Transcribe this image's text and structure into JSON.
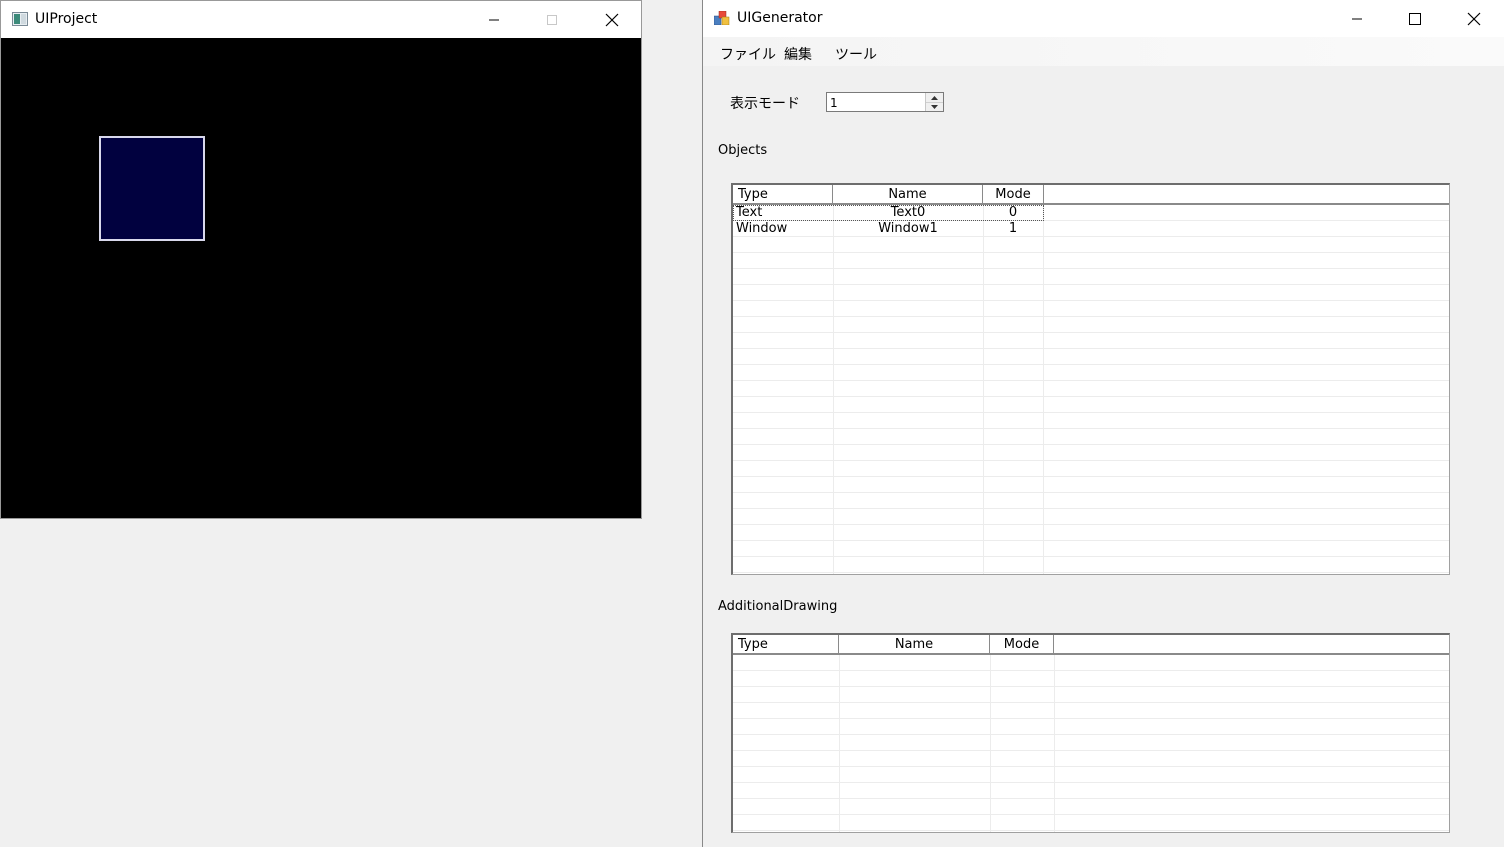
{
  "uiproject": {
    "title": "UIProject",
    "controls": {
      "minimize": "minimize-icon",
      "maximize": "maximize-icon",
      "close": "close-icon"
    },
    "canvas_bg": "#000000",
    "window_fill": "#01013f"
  },
  "uigenerator": {
    "title": "UIGenerator",
    "menu": [
      "ファイル",
      "編集",
      "ツール"
    ],
    "display_mode": {
      "label": "表示モード",
      "value": "1"
    },
    "objects": {
      "label": "Objects",
      "columns": [
        "Type",
        "Name",
        "Mode"
      ],
      "rows": [
        {
          "type": "Text",
          "name": "Text0",
          "mode": "0"
        },
        {
          "type": "Window",
          "name": "Window1",
          "mode": "1"
        }
      ]
    },
    "additional": {
      "label": "AdditionalDrawing",
      "columns": [
        "Type",
        "Name",
        "Mode"
      ],
      "rows": []
    }
  }
}
